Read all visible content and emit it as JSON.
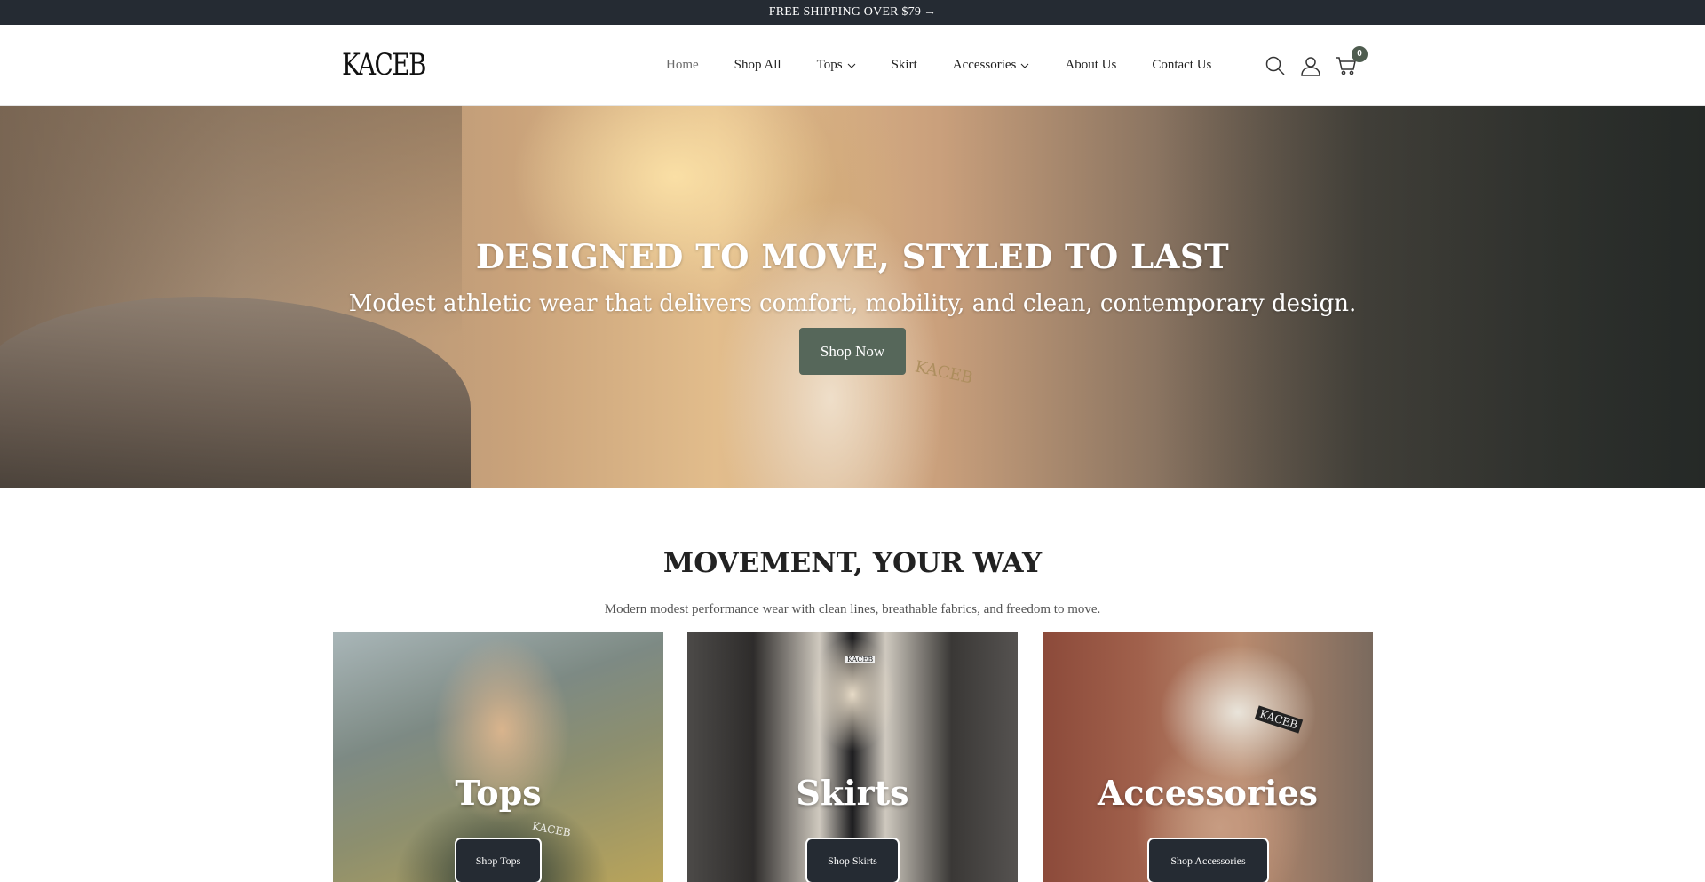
{
  "announcement": {
    "text": "FREE SHIPPING OVER $79",
    "arrow": "→"
  },
  "header": {
    "logo": "KACEB",
    "nav": [
      {
        "label": "Home",
        "active": true,
        "dropdown": false
      },
      {
        "label": "Shop All",
        "active": false,
        "dropdown": false
      },
      {
        "label": "Tops",
        "active": false,
        "dropdown": true
      },
      {
        "label": "Skirt",
        "active": false,
        "dropdown": false
      },
      {
        "label": "Accessories",
        "active": false,
        "dropdown": true
      },
      {
        "label": "About Us",
        "active": false,
        "dropdown": false
      },
      {
        "label": "Contact Us",
        "active": false,
        "dropdown": false
      }
    ],
    "icons": [
      "search-icon",
      "account-icon",
      "cart-icon"
    ],
    "cart_count": "0"
  },
  "hero": {
    "title": "DESIGNED TO MOVE, STYLED TO LAST",
    "subtitle": "Modest athletic wear that delivers comfort, mobility, and clean, contemporary design.",
    "button": "Shop Now",
    "shirt_mark": "KACEB"
  },
  "collections": {
    "title": "MOVEMENT, YOUR WAY",
    "subtitle": "Modern modest performance wear with clean lines, breathable fabrics, and freedom to move.",
    "cards": [
      {
        "title": "Tops",
        "button": "Shop Tops"
      },
      {
        "title": "Skirts",
        "button": "Shop Skirts"
      },
      {
        "title": "Accessories",
        "button": "Shop Accessories"
      }
    ],
    "marks": [
      "KACEB",
      "KACEB",
      "KACEB"
    ]
  },
  "colors": {
    "announcement_bg": "#252b33",
    "accent_button": "#56675a",
    "card_button": "#252b33",
    "cart_badge": "#4e5c4f"
  }
}
